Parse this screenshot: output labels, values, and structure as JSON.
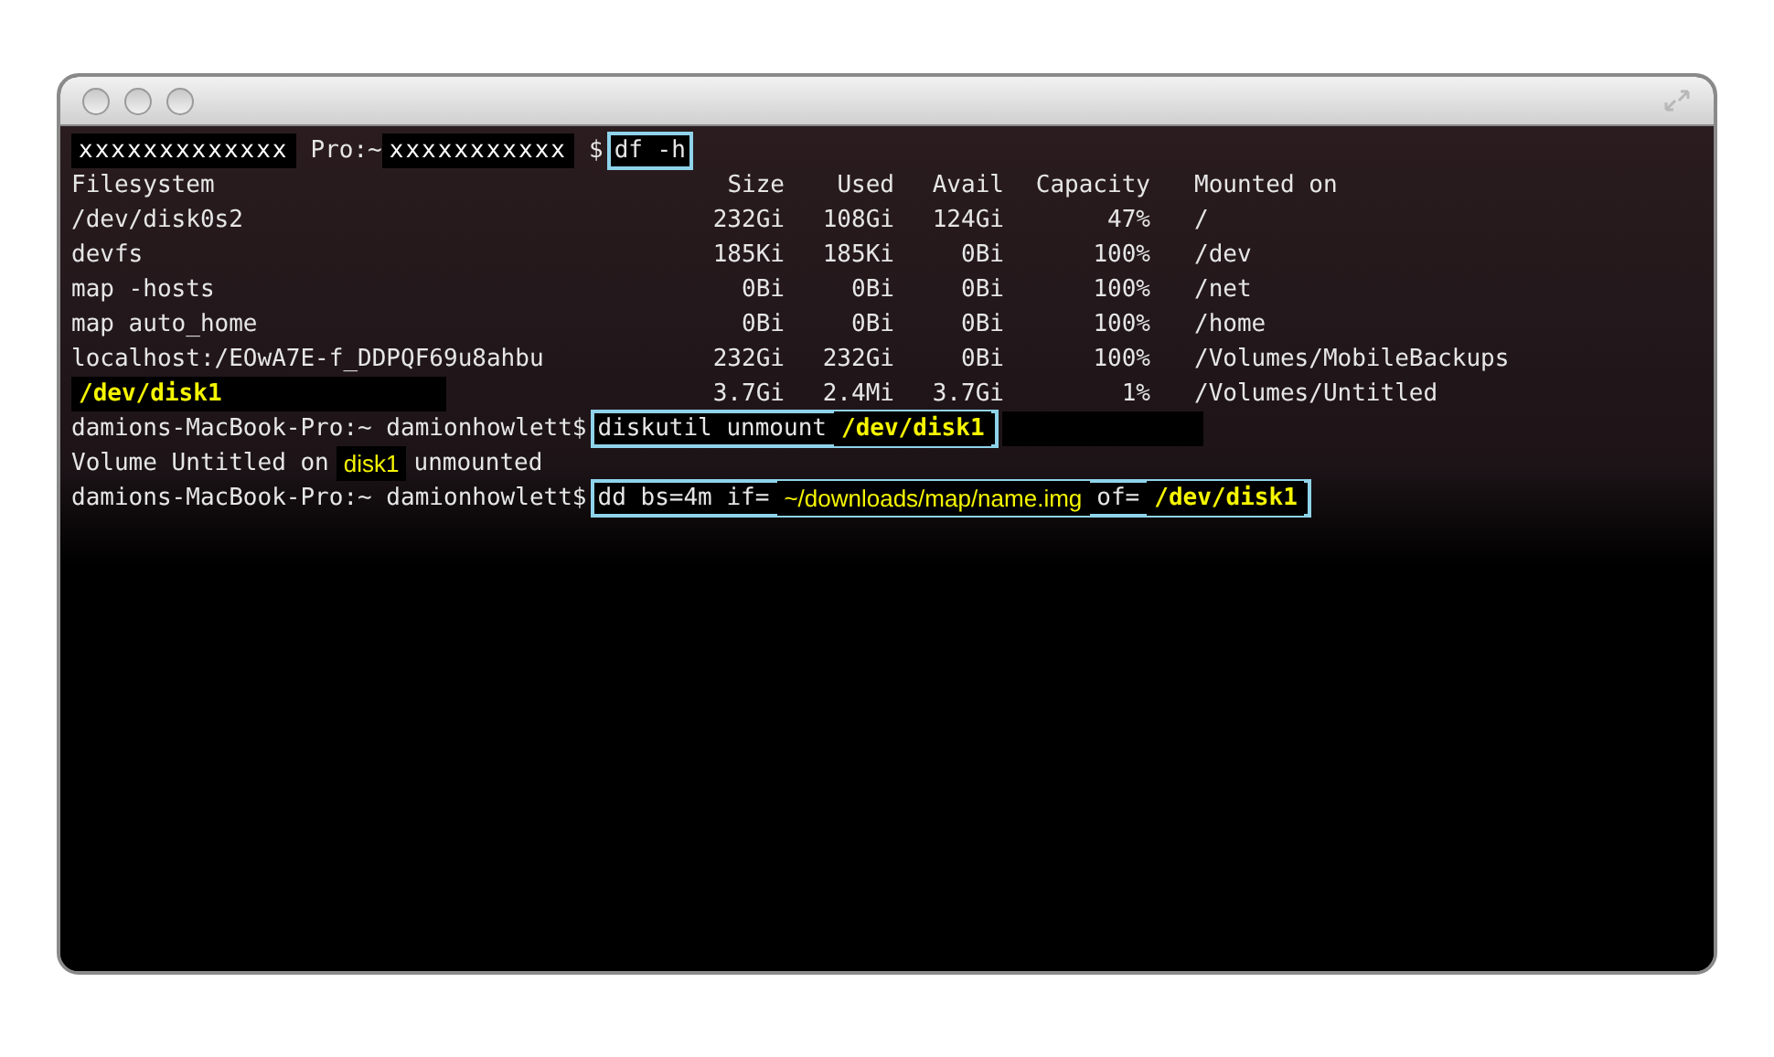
{
  "terminal": {
    "lines": [
      {
        "kind": "text",
        "segments": [
          {
            "kind": "mask",
            "text": "xxxxxxxxxxxxx"
          },
          {
            "kind": "plain",
            "text": "Pro:~"
          },
          {
            "kind": "mask",
            "text": "xxxxxxxxxxx"
          },
          {
            "kind": "plain",
            "text": "$"
          }
        ],
        "command": [
          {
            "kind": "plain",
            "text": "df -h"
          }
        ]
      },
      {
        "kind": "table",
        "columns": [
          "Filesystem",
          "Size",
          "Used",
          "Avail",
          "Capacity",
          "Mounted on"
        ],
        "rows": [
          {
            "masked": false,
            "cells": [
              "/dev/disk0s2",
              "232Gi",
              "108Gi",
              "124Gi",
              "47%",
              "/"
            ]
          },
          {
            "masked": false,
            "cells": [
              "devfs",
              "185Ki",
              "185Ki",
              "0Bi",
              "100%",
              "/dev"
            ]
          },
          {
            "masked": false,
            "cells": [
              "map -hosts",
              "0Bi",
              "0Bi",
              "0Bi",
              "100%",
              "/net"
            ]
          },
          {
            "masked": false,
            "cells": [
              "map auto_home",
              "0Bi",
              "0Bi",
              "0Bi",
              "100%",
              "/home"
            ]
          },
          {
            "masked": false,
            "cells": [
              "localhost:/EOwA7E-f_DDPQF69u8ahbu",
              "232Gi",
              "232Gi",
              "0Bi",
              "100%",
              "/Volumes/MobileBackups"
            ]
          },
          {
            "masked": true,
            "cells": [
              "/dev/disk1",
              "3.7Gi",
              "2.4Mi",
              "3.7Gi",
              "1%",
              "/Volumes/Untitled"
            ]
          }
        ]
      },
      {
        "kind": "text",
        "segments": [
          {
            "kind": "plain",
            "text": "damions-MacBook-Pro:~ damionhowlett$"
          }
        ],
        "command": [
          {
            "kind": "plain",
            "text": "diskutil unmount"
          },
          {
            "kind": "yellow",
            "text": "/dev/disk1"
          }
        ],
        "after": [
          {
            "kind": "redaction"
          }
        ]
      },
      {
        "kind": "text",
        "segments": [
          {
            "kind": "plain",
            "text": "Volume Untitled on"
          },
          {
            "kind": "yellow_sans",
            "text": "disk1"
          },
          {
            "kind": "plain",
            "text": "unmounted"
          }
        ]
      },
      {
        "kind": "text",
        "segments": [
          {
            "kind": "plain",
            "text": "damions-MacBook-Pro:~ damionhowlett$"
          }
        ],
        "command": [
          {
            "kind": "plain",
            "text": "dd bs=4m if="
          },
          {
            "kind": "yellow_sans",
            "text": "~/downloads/map/name.img"
          },
          {
            "kind": "plain",
            "text": "of="
          },
          {
            "kind": "yellow",
            "text": "/dev/disk1"
          }
        ]
      }
    ]
  }
}
